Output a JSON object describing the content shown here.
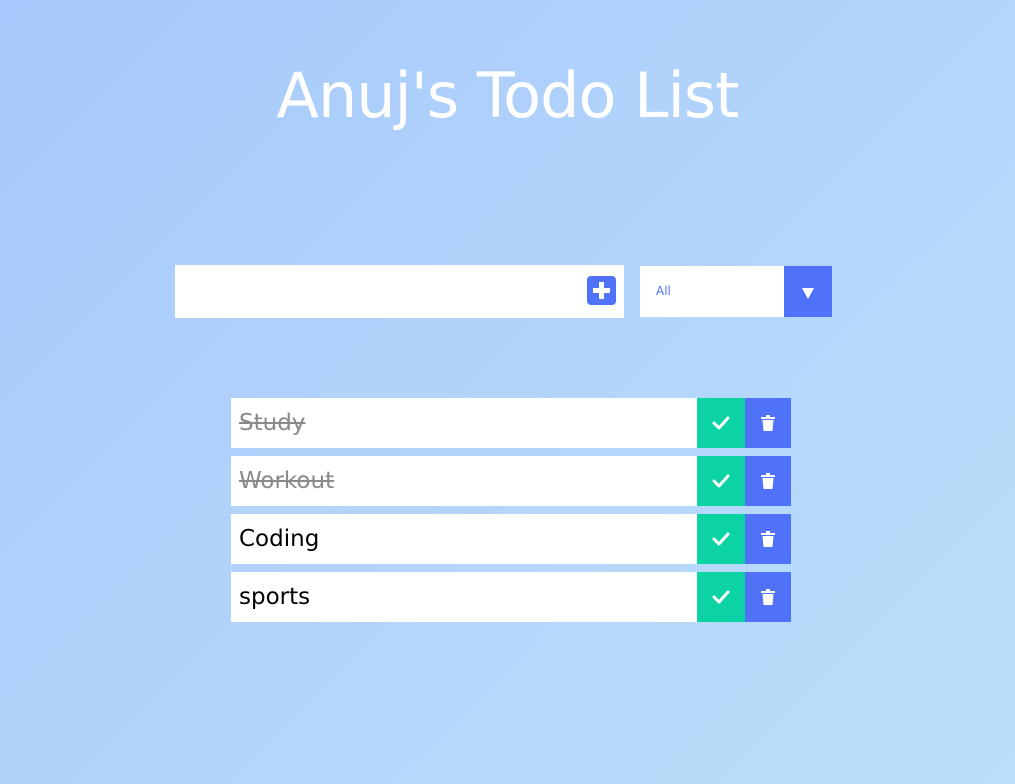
{
  "header": {
    "title": "Anuj's Todo List"
  },
  "form": {
    "input_value": "",
    "add_icon": "plus-square-icon",
    "filter_selected": "All",
    "filter_icon": "caret-down-icon"
  },
  "todos": [
    {
      "text": "Study",
      "completed": true
    },
    {
      "text": "Workout",
      "completed": true
    },
    {
      "text": "Coding",
      "completed": false
    },
    {
      "text": "sports",
      "completed": false
    }
  ],
  "colors": {
    "accent": "#4f72f9",
    "complete": "#0bd3a4",
    "completed_text": "#8a8a8a"
  }
}
